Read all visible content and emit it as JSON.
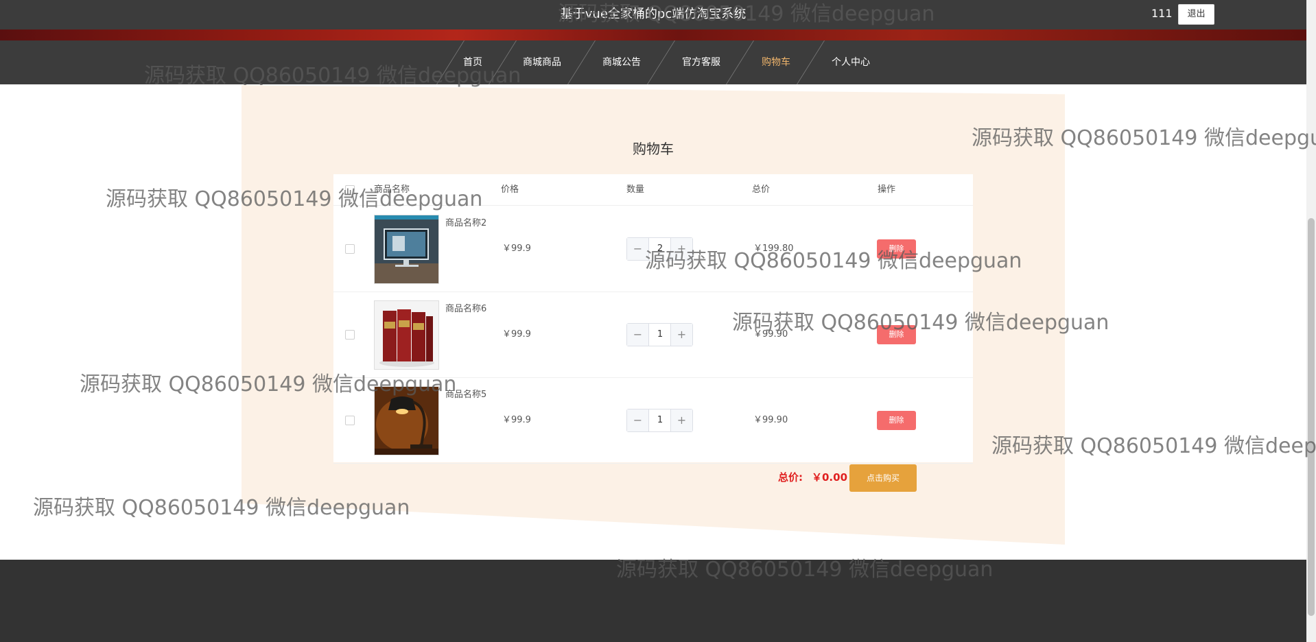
{
  "header": {
    "site_title": "基于vue全家桶的pc端仿淘宝系统",
    "user_name": "111",
    "logout_label": "退出"
  },
  "nav": {
    "items": [
      {
        "label": "首页"
      },
      {
        "label": "商城商品"
      },
      {
        "label": "商城公告"
      },
      {
        "label": "官方客服"
      },
      {
        "label": "购物车"
      },
      {
        "label": "个人中心"
      }
    ],
    "active_label": "购物车",
    "active_color": "#f0b56c"
  },
  "cart": {
    "title": "购物车",
    "columns": {
      "name": "商品名称",
      "price": "价格",
      "quantity": "数量",
      "total": "总价",
      "action": "操作"
    },
    "rows": [
      {
        "name": "商品名称2",
        "price": "￥99.9",
        "quantity": "2",
        "total": "￥199.80",
        "delete_label": "删除",
        "image_icon": "monitor-desk-photo"
      },
      {
        "name": "商品名称6",
        "price": "￥99.9",
        "quantity": "1",
        "total": "￥99.90",
        "delete_label": "删除",
        "image_icon": "red-book-set-photo"
      },
      {
        "name": "商品名称5",
        "price": "￥99.9",
        "quantity": "1",
        "total": "￥99.90",
        "delete_label": "删除",
        "image_icon": "desk-lamp-photo"
      }
    ],
    "stepper": {
      "minus": "−",
      "plus": "+"
    },
    "total_label": "总价:",
    "total_value": "￥0.00",
    "buy_label": "点击购买",
    "delete_color": "#f56c6c",
    "buy_color": "#e6a23c"
  },
  "watermark": {
    "text": "源码获取 QQ86050149 微信deepguan"
  }
}
